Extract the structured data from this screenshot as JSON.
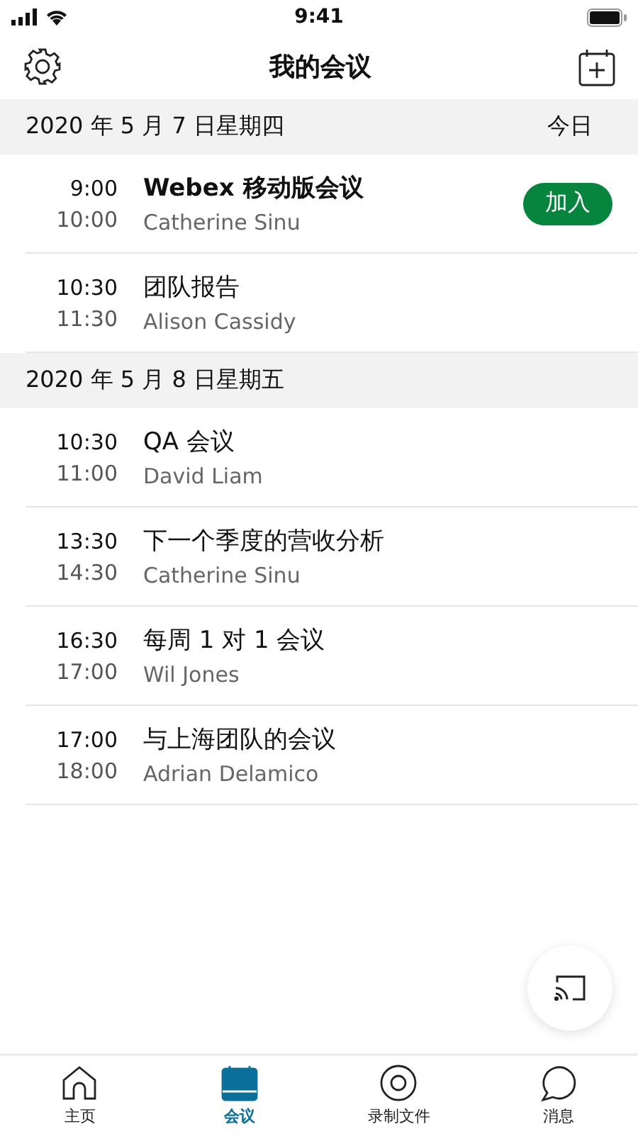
{
  "status_bar": {
    "time": "9:41"
  },
  "header": {
    "title": "我的会议"
  },
  "sections": [
    {
      "date": "2020 年 5 月 7 日星期四",
      "today": "今日",
      "meetings": [
        {
          "start": "9:00",
          "end": "10:00",
          "title": "Webex 移动版会议",
          "host": "Catherine Sinu",
          "bold": true,
          "join": "加入"
        },
        {
          "start": "10:30",
          "end": "11:30",
          "title": "团队报告",
          "host": "Alison Cassidy",
          "bold": false
        }
      ]
    },
    {
      "date": "2020 年 5 月 8 日星期五",
      "meetings": [
        {
          "start": "10:30",
          "end": "11:00",
          "title": "QA 会议",
          "host": "David Liam",
          "bold": false
        },
        {
          "start": "13:30",
          "end": "14:30",
          "title": "下一个季度的营收分析",
          "host": "Catherine Sinu",
          "bold": false
        },
        {
          "start": "16:30",
          "end": "17:00",
          "title": "每周 1 对 1 会议",
          "host": "Wil Jones",
          "bold": false
        },
        {
          "start": "17:00",
          "end": "18:00",
          "title": "与上海团队的会议",
          "host": "Adrian Delamico",
          "bold": false
        }
      ]
    }
  ],
  "tab_bar": [
    {
      "kind": "home",
      "label": "主页",
      "selected": false
    },
    {
      "kind": "meetings",
      "label": "会议",
      "selected": true
    },
    {
      "kind": "recordings",
      "label": "录制文件",
      "selected": false
    },
    {
      "kind": "messages",
      "label": "消息",
      "selected": false
    }
  ]
}
